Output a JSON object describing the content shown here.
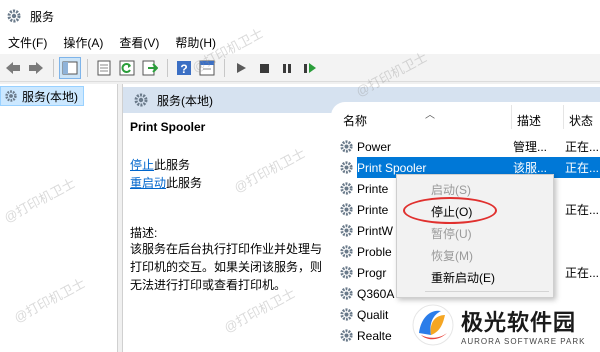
{
  "window": {
    "title": "服务"
  },
  "menu": [
    "文件(F)",
    "操作(A)",
    "查看(V)",
    "帮助(H)"
  ],
  "toolbar": {
    "buttons": [
      "back-icon",
      "forward-icon",
      "show-tree-icon",
      "properties-icon",
      "refresh-icon",
      "export-icon",
      "help-icon",
      "console-icon",
      "start-icon",
      "stop-icon",
      "pause-icon",
      "restart-icon"
    ]
  },
  "tree": {
    "item_label": "服务(本地)"
  },
  "panel": {
    "header": "服务(本地)"
  },
  "detail": {
    "service_name": "Print Spooler",
    "stop_link": "停止",
    "stop_suffix": "此服务",
    "restart_link": "重启动",
    "restart_suffix": "此服务",
    "desc_label": "描述:",
    "desc_text": "该服务在后台执行打印作业并处理与打印机的交互。如果关闭该服务，则无法进行打印或查看打印机。"
  },
  "list": {
    "columns": [
      "名称",
      "描述",
      "状态"
    ],
    "rows": [
      {
        "name": "Power",
        "desc": "管理...",
        "status": "正在..."
      },
      {
        "name": "Print Spooler",
        "desc": "该服...",
        "status": "正在...",
        "selected": true
      },
      {
        "name": "Printe",
        "desc": "",
        "status": ""
      },
      {
        "name": "Printe",
        "desc": "",
        "status": "正在..."
      },
      {
        "name": "PrintW",
        "desc": "",
        "status": ""
      },
      {
        "name": "Proble",
        "desc": "",
        "status": ""
      },
      {
        "name": "Progr",
        "desc": "",
        "status": "正在..."
      },
      {
        "name": "Q360A",
        "desc": "",
        "status": ""
      },
      {
        "name": "Qualit",
        "desc": "",
        "status": ""
      },
      {
        "name": "Realte",
        "desc": "",
        "status": ""
      }
    ]
  },
  "context_menu": {
    "items": [
      {
        "label": "启动(S)",
        "enabled": false
      },
      {
        "label": "停止(O)",
        "enabled": true
      },
      {
        "label": "暂停(U)",
        "enabled": false
      },
      {
        "label": "恢复(M)",
        "enabled": false
      },
      {
        "label": "重新启动(E)",
        "enabled": true
      }
    ]
  },
  "watermark": "@打印机卫士",
  "logo": {
    "name_cn": "极光软件园",
    "name_en": "AURORA SOFTWARE PARK"
  },
  "colors": {
    "selection": "#0078d7",
    "header_band": "#d6e2f0",
    "highlight_ring": "#e0302e",
    "link": "#0066cc"
  }
}
